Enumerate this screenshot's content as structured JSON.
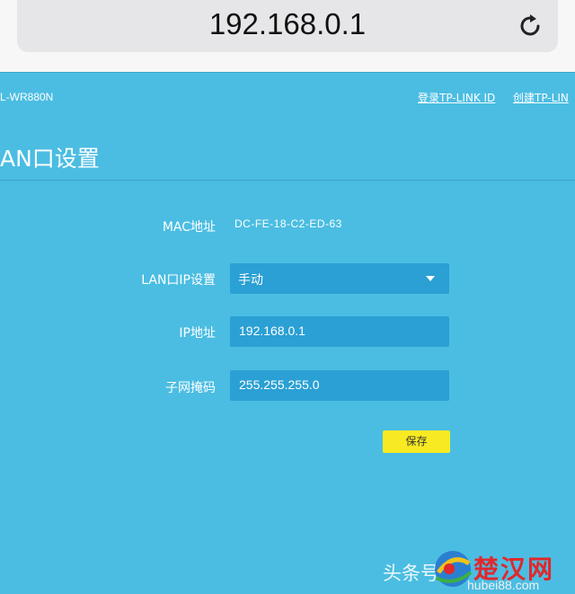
{
  "browser": {
    "url": "192.168.0.1"
  },
  "header": {
    "model": "L-WR880N",
    "login_link": "登录TP-LINK ID",
    "create_link": "创建TP-LIN"
  },
  "page": {
    "title": "AN口设置"
  },
  "form": {
    "mac_label": "MAC地址",
    "mac_value": "DC-FE-18-C2-ED-63",
    "mode_label": "LAN口IP设置",
    "mode_value": "手动",
    "ip_label": "IP地址",
    "ip_value": "192.168.0.1",
    "mask_label": "子网掩码",
    "mask_value": "255.255.255.0",
    "save_label": "保存"
  },
  "watermark": {
    "text": "头条号/",
    "logo_text": "楚汉网",
    "logo_url": "hubei88.com"
  },
  "colors": {
    "page_bg": "#4bbde2",
    "field_bg": "#2aa0d4",
    "save_button": "#f7ea23",
    "logo_red": "#e0282d"
  }
}
